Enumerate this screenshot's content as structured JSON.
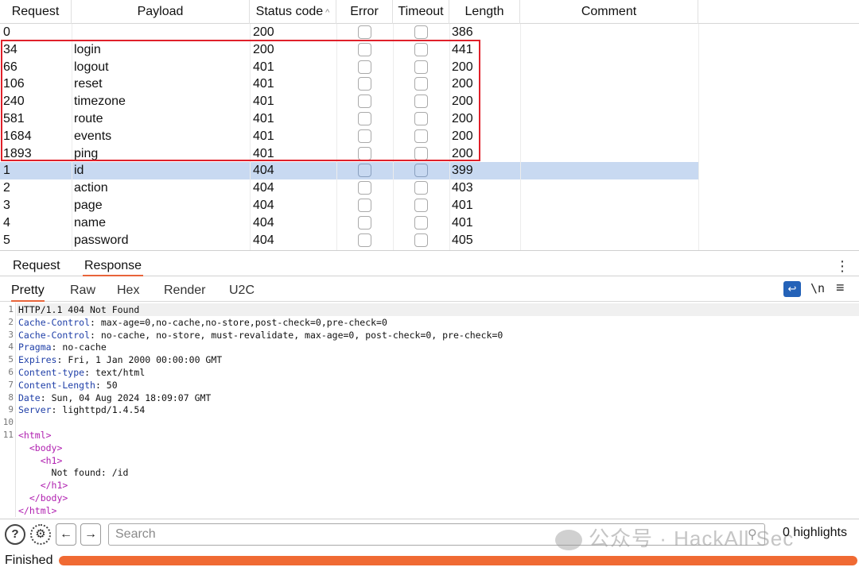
{
  "table": {
    "columns": [
      "Request",
      "Payload",
      "Status code",
      "Error",
      "Timeout",
      "Length",
      "Comment"
    ],
    "sort_indicator": "^",
    "rows": [
      {
        "request": "0",
        "payload": "",
        "status": "200",
        "error": false,
        "timeout": false,
        "length": "386",
        "comment": ""
      },
      {
        "request": "34",
        "payload": "login",
        "status": "200",
        "error": false,
        "timeout": false,
        "length": "441",
        "comment": ""
      },
      {
        "request": "66",
        "payload": "logout",
        "status": "401",
        "error": false,
        "timeout": false,
        "length": "200",
        "comment": ""
      },
      {
        "request": "106",
        "payload": "reset",
        "status": "401",
        "error": false,
        "timeout": false,
        "length": "200",
        "comment": ""
      },
      {
        "request": "240",
        "payload": "timezone",
        "status": "401",
        "error": false,
        "timeout": false,
        "length": "200",
        "comment": ""
      },
      {
        "request": "581",
        "payload": "route",
        "status": "401",
        "error": false,
        "timeout": false,
        "length": "200",
        "comment": ""
      },
      {
        "request": "1684",
        "payload": "events",
        "status": "401",
        "error": false,
        "timeout": false,
        "length": "200",
        "comment": ""
      },
      {
        "request": "1893",
        "payload": "ping",
        "status": "401",
        "error": false,
        "timeout": false,
        "length": "200",
        "comment": ""
      },
      {
        "request": "1",
        "payload": "id",
        "status": "404",
        "error": false,
        "timeout": false,
        "length": "399",
        "comment": "",
        "selected": true
      },
      {
        "request": "2",
        "payload": "action",
        "status": "404",
        "error": false,
        "timeout": false,
        "length": "403",
        "comment": ""
      },
      {
        "request": "3",
        "payload": "page",
        "status": "404",
        "error": false,
        "timeout": false,
        "length": "401",
        "comment": ""
      },
      {
        "request": "4",
        "payload": "name",
        "status": "404",
        "error": false,
        "timeout": false,
        "length": "401",
        "comment": ""
      },
      {
        "request": "5",
        "payload": "password",
        "status": "404",
        "error": false,
        "timeout": false,
        "length": "405",
        "comment": ""
      }
    ],
    "highlight_color": "#e0202a",
    "selected_color": "#c8d9f1"
  },
  "message_tabs": {
    "items": [
      "Request",
      "Response"
    ],
    "active": "Response",
    "more_icon": "kebab-menu-icon"
  },
  "view_tabs": {
    "items": [
      "Pretty",
      "Raw",
      "Hex",
      "Render",
      "U2C"
    ],
    "active": "Pretty",
    "wrap_icon": "wrap-lines-icon",
    "newline_label": "\\n",
    "menu_icon": "hamburger-menu-icon"
  },
  "response_lines": [
    {
      "n": "1",
      "key": "",
      "sep": "",
      "value": "HTTP/1.1 404 Not Found",
      "type": "status"
    },
    {
      "n": "2",
      "key": "Cache-Control",
      "sep": ": ",
      "value": "max-age=0,no-cache,no-store,post-check=0,pre-check=0",
      "type": "header"
    },
    {
      "n": "3",
      "key": "Cache-Control",
      "sep": ": ",
      "value": "no-cache, no-store, must-revalidate, max-age=0, post-check=0, pre-check=0",
      "type": "header"
    },
    {
      "n": "4",
      "key": "Pragma",
      "sep": ": ",
      "value": "no-cache",
      "type": "header"
    },
    {
      "n": "5",
      "key": "Expires",
      "sep": ": ",
      "value": "Fri, 1 Jan 2000 00:00:00 GMT",
      "type": "header"
    },
    {
      "n": "6",
      "key": "Content-type",
      "sep": ": ",
      "value": "text/html",
      "type": "header"
    },
    {
      "n": "7",
      "key": "Content-Length",
      "sep": ": ",
      "value": "50",
      "type": "header"
    },
    {
      "n": "8",
      "key": "Date",
      "sep": ": ",
      "value": "Sun, 04 Aug 2024 18:09:07 GMT",
      "type": "header"
    },
    {
      "n": "9",
      "key": "Server",
      "sep": ": ",
      "value": "lighttpd/1.4.54",
      "type": "header"
    },
    {
      "n": "10",
      "key": "",
      "sep": "",
      "value": "",
      "type": "blank"
    },
    {
      "n": "11",
      "key": "",
      "sep": "",
      "value": "<html>",
      "type": "tag"
    },
    {
      "n": "",
      "key": "",
      "sep": "",
      "value": "  <body>",
      "type": "tag"
    },
    {
      "n": "",
      "key": "",
      "sep": "",
      "value": "    <h1>",
      "type": "tag"
    },
    {
      "n": "",
      "key": "",
      "sep": "",
      "value": "      Not found: /id",
      "type": "text"
    },
    {
      "n": "",
      "key": "",
      "sep": "",
      "value": "    </h1>",
      "type": "tag"
    },
    {
      "n": "",
      "key": "",
      "sep": "",
      "value": "  </body>",
      "type": "tag"
    },
    {
      "n": "",
      "key": "",
      "sep": "",
      "value": "</html>",
      "type": "tag"
    }
  ],
  "search": {
    "placeholder": "Search",
    "value": "",
    "highlights": "0 highlights",
    "help_icon": "help-icon",
    "settings_icon": "gear-icon",
    "back_icon": "arrow-left-icon",
    "forward_icon": "arrow-right-icon"
  },
  "watermark": "公众号 · HackAll Sec",
  "status": {
    "label": "Finished",
    "progress": 1.0,
    "color": "#f06a33"
  }
}
